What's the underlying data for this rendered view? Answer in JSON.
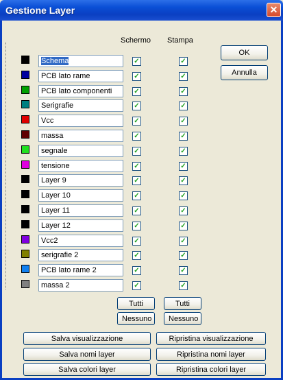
{
  "window": {
    "title": "Gestione Layer",
    "close_symbol": "✕"
  },
  "columns": {
    "screen": "Schermo",
    "print": "Stampa"
  },
  "check_mark": "✓",
  "layers": [
    {
      "name": "Schema",
      "color": "#000000",
      "screen": true,
      "print": true,
      "selected": true
    },
    {
      "name": "PCB lato rame",
      "color": "#0000a0",
      "screen": true,
      "print": true
    },
    {
      "name": "PCB lato componenti",
      "color": "#00a000",
      "screen": true,
      "print": true
    },
    {
      "name": "Serigrafie",
      "color": "#008080",
      "screen": true,
      "print": true
    },
    {
      "name": "Vcc",
      "color": "#e00000",
      "screen": true,
      "print": true
    },
    {
      "name": "massa",
      "color": "#600000",
      "screen": true,
      "print": true
    },
    {
      "name": "segnale",
      "color": "#20e020",
      "screen": true,
      "print": true
    },
    {
      "name": "tensione",
      "color": "#e000e0",
      "screen": true,
      "print": true
    },
    {
      "name": "Layer 9",
      "color": "#000000",
      "screen": true,
      "print": true
    },
    {
      "name": "Layer 10",
      "color": "#000000",
      "screen": true,
      "print": true
    },
    {
      "name": "Layer 11",
      "color": "#000000",
      "screen": true,
      "print": true
    },
    {
      "name": "Layer 12",
      "color": "#000000",
      "screen": true,
      "print": true
    },
    {
      "name": "Vcc2",
      "color": "#8000e0",
      "screen": true,
      "print": true
    },
    {
      "name": "serigrafie 2",
      "color": "#808000",
      "screen": true,
      "print": true
    },
    {
      "name": "PCB lato rame 2",
      "color": "#1080f0",
      "screen": true,
      "print": true
    },
    {
      "name": "massa 2",
      "color": "#808080",
      "screen": true,
      "print": true
    }
  ],
  "buttons": {
    "ok": "OK",
    "cancel": "Annulla",
    "screen_all": "Tutti",
    "screen_none": "Nessuno",
    "print_all": "Tutti",
    "print_none": "Nessuno",
    "save_view": "Salva visualizzazione",
    "restore_view": "Ripristina visualizzazione",
    "save_names": "Salva nomi layer",
    "restore_names": "Ripristina nomi layer",
    "save_colors": "Salva colori layer",
    "restore_colors": "Ripristina colori layer"
  }
}
